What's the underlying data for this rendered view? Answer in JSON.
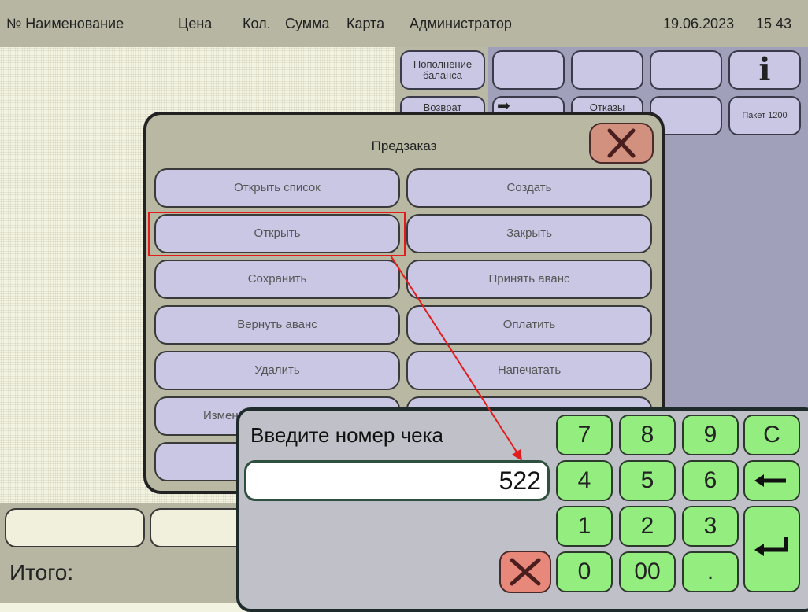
{
  "header": {
    "col_number_name": "№ Наименование",
    "col_price": "Цена",
    "col_qty": "Кол.",
    "col_sum": "Сумма",
    "col_card": "Карта",
    "user": "Администратор",
    "date": "19.06.2023",
    "time": "15 43"
  },
  "grid": {
    "balance_topup": "Пополнение баланса",
    "refund": "Возврат",
    "back_partial": "Отказы",
    "package": "Пакет 1200"
  },
  "preorder": {
    "title": "Предзаказ",
    "buttons": {
      "open_list": "Открыть список",
      "create": "Создать",
      "open": "Открыть",
      "close": "Закрыть",
      "save": "Сохранить",
      "accept_advance": "Принять аванс",
      "return_advance": "Вернуть аванс",
      "pay": "Оплатить",
      "delete": "Удалить",
      "print": "Напечатать",
      "change": "Изменить"
    }
  },
  "numpad": {
    "prompt": "Введите номер чека",
    "value": "522",
    "keys": {
      "k7": "7",
      "k8": "8",
      "k9": "9",
      "clear": "C",
      "k4": "4",
      "k5": "5",
      "k6": "6",
      "k1": "1",
      "k2": "2",
      "k3": "3",
      "k0": "0",
      "k00": "00",
      "dot": "."
    }
  },
  "footer": {
    "total_label": "Итого:"
  },
  "colors": {
    "accent_red": "#e21c1c",
    "key_green": "#93ed7f",
    "button_lavender": "#c9c7e3"
  }
}
